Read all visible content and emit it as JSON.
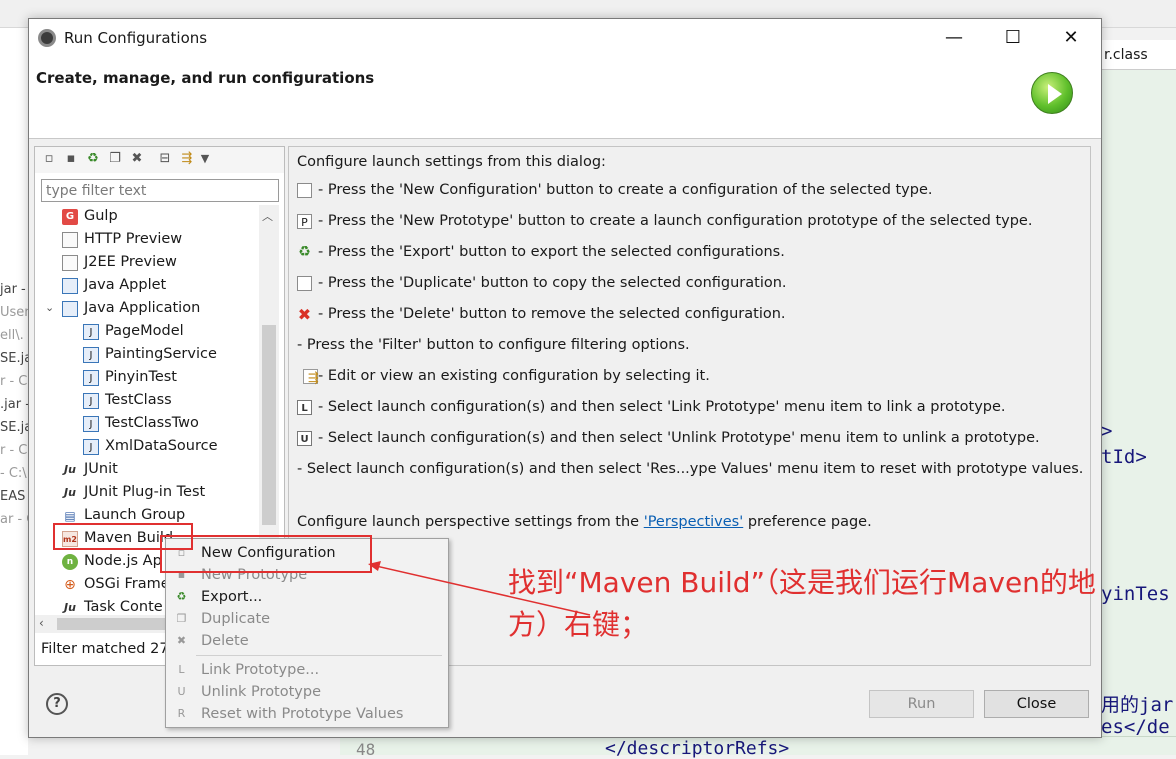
{
  "background": {
    "left_fragments": [
      "jar -",
      "Usen",
      "ell\\.",
      "SE.ja",
      "r - C",
      ".jar -",
      "SE.ja",
      "r - C",
      "- C:\\",
      "EAS",
      "ar - C"
    ],
    "right_tab": "r.class",
    "right_code": [
      ">",
      "tId>",
      "yinTes",
      "用的jar",
      "es</de"
    ],
    "bottom_line_number": "48",
    "bottom_code": "</descriptorRefs>"
  },
  "dialog": {
    "title": "Run Configurations",
    "header_title": "Create, manage, and run configurations",
    "window_controls": {
      "minimize": "—",
      "maximize": "☐",
      "close": "✕"
    },
    "filter": {
      "placeholder": "type filter text",
      "value": ""
    },
    "tree": [
      {
        "label": "Gulp",
        "icon": "gulp-icon",
        "glyph": "G"
      },
      {
        "label": "HTTP Preview",
        "icon": "file-icon",
        "glyph": ""
      },
      {
        "label": "J2EE Preview",
        "icon": "file-icon",
        "glyph": ""
      },
      {
        "label": "Java Applet",
        "icon": "applet-icon",
        "glyph": ""
      },
      {
        "label": "Java Application",
        "icon": "java-app-icon",
        "glyph": ""
      },
      {
        "label": "PageModel",
        "icon": "java-class-icon",
        "glyph": "J"
      },
      {
        "label": "PaintingService",
        "icon": "java-class-icon",
        "glyph": "J"
      },
      {
        "label": "PinyinTest",
        "icon": "java-class-icon",
        "glyph": "J"
      },
      {
        "label": "TestClass",
        "icon": "java-class-icon",
        "glyph": "J"
      },
      {
        "label": "TestClassTwo",
        "icon": "java-class-icon",
        "glyph": "J"
      },
      {
        "label": "XmlDataSource",
        "icon": "java-class-icon",
        "glyph": "J"
      },
      {
        "label": "JUnit",
        "icon": "junit-icon",
        "glyph": "Ju"
      },
      {
        "label": "JUnit Plug-in Test",
        "icon": "junit-plugin-icon",
        "glyph": "Ju"
      },
      {
        "label": "Launch Group",
        "icon": "launch-group-icon",
        "glyph": "▤"
      },
      {
        "label": "Maven Build",
        "icon": "maven-icon",
        "glyph": "m2"
      },
      {
        "label": "Node.js Ap",
        "icon": "nodejs-icon",
        "glyph": "n"
      },
      {
        "label": "OSGi Frame",
        "icon": "osgi-icon",
        "glyph": "⊕"
      },
      {
        "label": "Task Conte",
        "icon": "task-context-icon",
        "glyph": "Ju"
      }
    ],
    "filter_status": "Filter matched 27",
    "info": {
      "intro": "Configure launch settings from this dialog:",
      "lines": [
        "- Press the 'New Configuration' button to create a configuration of the selected type.",
        "- Press the 'New Prototype' button to create a launch configuration prototype of the selected type.",
        "- Press the 'Export' button to export the selected configurations.",
        "- Press the 'Duplicate' button to copy the selected configuration.",
        "- Press the 'Delete' button to remove the selected configuration.",
        "- Press the 'Filter' button to configure filtering options.",
        "- Edit or view an existing configuration by selecting it.",
        "- Select launch configuration(s) and then select 'Link Prototype' menu item to link a prototype.",
        "- Select launch configuration(s) and then select 'Unlink Prototype' menu item to unlink a prototype.",
        "- Select launch configuration(s) and then select 'Res...ype Values' menu item to reset with prototype values."
      ],
      "perspective_prefix": "Configure launch perspective settings from the ",
      "perspective_link": "'Perspectives'",
      "perspective_suffix": " preference page."
    },
    "buttons": {
      "run": "Run",
      "close": "Close",
      "help": "?"
    }
  },
  "context_menu": {
    "items": [
      {
        "label": "New Configuration",
        "enabled": true
      },
      {
        "label": "New Prototype",
        "enabled": false
      },
      {
        "label": "Export...",
        "enabled": true
      },
      {
        "label": "Duplicate",
        "enabled": false
      },
      {
        "label": "Delete",
        "enabled": false
      },
      {
        "label": "Link Prototype...",
        "enabled": false
      },
      {
        "label": "Unlink Prototype",
        "enabled": false
      },
      {
        "label": "Reset with Prototype Values",
        "enabled": false
      }
    ]
  },
  "annotation": {
    "text_line1": "找到“Maven Build”（这是我们运行Maven的地",
    "text_line2": "方）右键；",
    "color": "#e03030"
  }
}
